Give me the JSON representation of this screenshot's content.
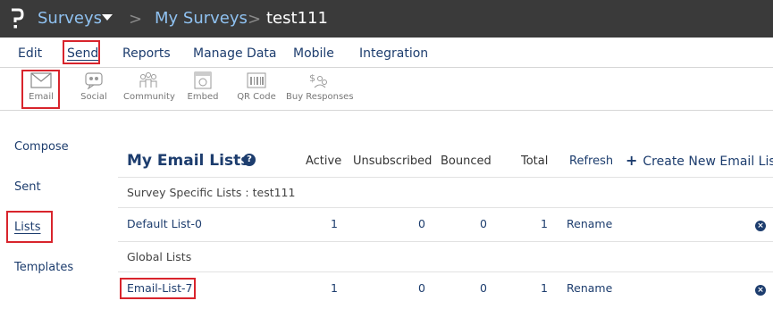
{
  "breadcrumb": {
    "app": "Surveys",
    "section": "My Surveys",
    "current": "test111",
    "separator": ">"
  },
  "menu": {
    "items": [
      "Edit",
      "Send",
      "Reports",
      "Manage Data",
      "Mobile",
      "Integration"
    ],
    "active": "Send"
  },
  "toolbar": {
    "items": [
      {
        "label": "Email",
        "icon": "envelope-icon"
      },
      {
        "label": "Social",
        "icon": "social-icon"
      },
      {
        "label": "Community",
        "icon": "community-icon"
      },
      {
        "label": "Embed",
        "icon": "embed-icon"
      },
      {
        "label": "QR Code",
        "icon": "qr-code-icon"
      },
      {
        "label": "Buy Responses",
        "icon": "buy-responses-icon"
      }
    ]
  },
  "sidebar": {
    "items": [
      "Compose",
      "Sent",
      "Lists",
      "Templates"
    ],
    "active": "Lists"
  },
  "lists": {
    "title": "My Email Lists",
    "help_symbol": "?",
    "columns": {
      "active": "Active",
      "unsubscribed": "Unsubscribed",
      "bounced": "Bounced",
      "total": "Total",
      "refresh": "Refresh"
    },
    "create_symbol": "+",
    "create_label": "Create New Email List",
    "groups": [
      {
        "label": "Survey Specific Lists : test111",
        "rows": [
          {
            "name": "Default List-0",
            "active": "1",
            "unsubscribed": "0",
            "bounced": "0",
            "total": "1",
            "action": "Rename"
          }
        ]
      },
      {
        "label": "Global Lists",
        "rows": [
          {
            "name": "Email-List-7",
            "active": "1",
            "unsubscribed": "0",
            "bounced": "0",
            "total": "1",
            "action": "Rename"
          }
        ]
      }
    ],
    "delete_symbol": "×"
  },
  "colors": {
    "topbar": "#3a3a3a",
    "link": "#1d3d6e",
    "breadcrumb_link": "#8fc1f0",
    "highlight": "#d8242c"
  }
}
